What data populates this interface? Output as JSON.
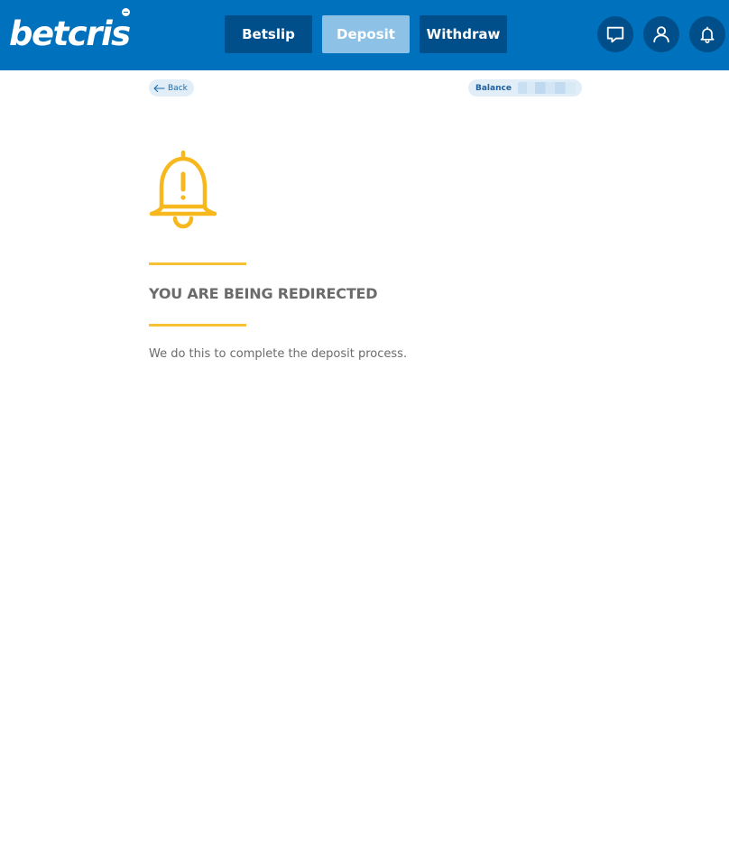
{
  "header": {
    "logo_text": "betcris",
    "brand_color": "#0071bc",
    "nav": {
      "betslip_label": "Betslip",
      "deposit_label": "Deposit",
      "withdraw_label": "Withdraw"
    },
    "icons": [
      "chat-icon",
      "account-icon",
      "bell-icon"
    ]
  },
  "subbar": {
    "back_label": "Back",
    "balance_label": "Balance"
  },
  "main": {
    "icon": "warning-bell-icon",
    "accent_color": "#f6c233",
    "title": "YOU ARE BEING REDIRECTED",
    "message": "We do this to complete the deposit process."
  }
}
